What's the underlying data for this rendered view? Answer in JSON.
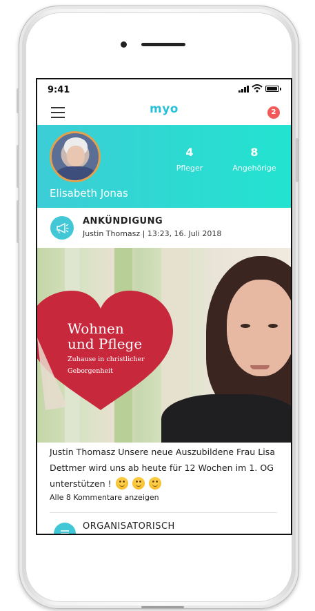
{
  "status_bar": {
    "time": "9:41"
  },
  "nav": {
    "logo": "myo",
    "notification_count": "2"
  },
  "profile": {
    "name": "Elisabeth Jonas",
    "stats": [
      {
        "value": "4",
        "label": "Pfleger"
      },
      {
        "value": "8",
        "label": "Angehörige"
      }
    ]
  },
  "post": {
    "category": "ANKÜNDIGUNG",
    "meta": "Justin Thomasz | 13:23, 16. Juli 2018",
    "image_text": {
      "line1": "Wohnen",
      "line2": "und Pflege",
      "tagline1": "Zuhause in christlicher",
      "tagline2": "Geborgenheit"
    },
    "caption": "Justin Thomasz Unsere neue Auszubildene Frau Lisa Dettmer wird uns ab heute für 12 Wochen im 1. OG unterstützen !",
    "emoji_count": 3,
    "comments_link": "Alle 8 Kommentare anzeigen"
  },
  "next_post": {
    "category": "ORGANISATORISCH"
  },
  "colors": {
    "accent": "#2ac0d9",
    "header_gradient_start": "#3ccdd6",
    "header_gradient_end": "#22e3cf",
    "badge": "#f25a5a",
    "heart": "#c8283c"
  },
  "icons": {
    "menu": "hamburger-icon",
    "announcement": "megaphone-icon",
    "organizational": "list-icon"
  }
}
